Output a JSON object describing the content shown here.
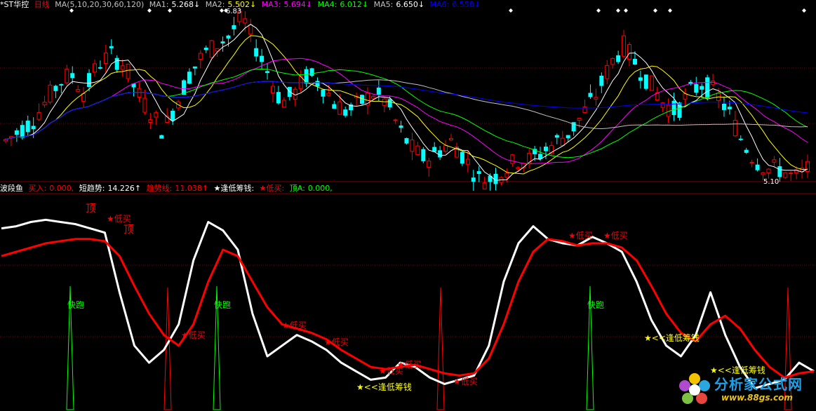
{
  "colors": {
    "white": "#ffffff",
    "yellow": "#ffff00",
    "magenta": "#ff00ff",
    "green": "#00ff00",
    "blue": "#0000ff",
    "red": "#ff0000",
    "cyan": "#00ffff",
    "gray": "#c0c0c0",
    "sep": "#800000",
    "mid": "#666666"
  },
  "top_legend": {
    "symbol": "*ST华控",
    "period": "日线",
    "ma_label": "MA(5,10,20,30,60,120)",
    "ma1_label": "MA1:",
    "ma1_value": "5.268↓",
    "ma2_label": "MA2:",
    "ma2_value": "5.502↓",
    "ma3_label": "MA3:",
    "ma3_value": "5.694↓",
    "ma4_label": "MA4:",
    "ma4_value": "6.012↓",
    "ma5_label": "MA5:",
    "ma5_value": "6.650↓",
    "ma6_label": "MA6:",
    "ma6_value": "6.558↓"
  },
  "bottom_legend": {
    "indicator": "波段鱼",
    "buy_label": "买入:",
    "buy_value": "0.000,",
    "short_label": "短趋势:",
    "short_value": "14.226↑",
    "trend_label": "趋势线:",
    "trend_value": "11.038↑",
    "chip_label": "★逢低筹钱:",
    "lowbuy_label": "★低买:",
    "top_label": "顶A:",
    "top_value": "0.000,"
  },
  "price_labels": {
    "high": "6.83",
    "low": "5.10"
  },
  "annotations": {
    "top": "顶",
    "low_buy": "★低买",
    "quick_run": "快跑",
    "chip": "★<<逢低筹钱"
  },
  "watermark": {
    "name": "分析家公式网",
    "url": "www.88gs.com"
  },
  "chart_data": [
    {
      "type": "candlestick",
      "price_range": [
        5.1,
        6.83
      ],
      "close_trend": [
        5.5,
        5.6,
        5.7,
        5.9,
        6.1,
        6.2,
        6.0,
        6.3,
        6.4,
        6.3,
        6.0,
        5.8,
        5.6,
        5.9,
        6.2,
        6.4,
        6.5,
        6.6,
        6.8,
        6.5,
        6.2,
        5.9,
        6.0,
        6.2,
        6.1,
        5.9,
        5.8,
        5.9,
        6.0,
        5.9,
        5.6,
        5.4,
        5.3,
        5.4,
        5.5,
        5.3,
        5.1,
        5.1,
        5.2,
        5.3,
        5.3,
        5.4,
        5.5,
        5.6,
        5.8,
        6.0,
        6.3,
        6.5,
        6.3,
        6.1,
        5.9,
        5.8,
        6.0,
        6.1,
        6.0,
        5.8,
        5.5,
        5.3,
        5.2,
        5.2,
        5.1,
        5.2
      ],
      "moving_averages": [
        "MA1",
        "MA2",
        "MA3",
        "MA4",
        "MA5",
        "MA6"
      ]
    },
    {
      "type": "line",
      "series": [
        {
          "name": "短趋势",
          "values": [
            85,
            86,
            88,
            89,
            88,
            87,
            85,
            83,
            55,
            30,
            22,
            28,
            40,
            70,
            88,
            84,
            75,
            45,
            25,
            30,
            35,
            32,
            28,
            22,
            18,
            14,
            15,
            22,
            20,
            15,
            12,
            14,
            16,
            30,
            60,
            78,
            86,
            80,
            78,
            77,
            81,
            78,
            74,
            60,
            42,
            30,
            25,
            35,
            55,
            35,
            20,
            10,
            12,
            14,
            22,
            18
          ]
        },
        {
          "name": "趋势线",
          "values": [
            72,
            74,
            76,
            78,
            79,
            80,
            80,
            79,
            72,
            58,
            45,
            35,
            30,
            40,
            60,
            75,
            72,
            60,
            48,
            40,
            38,
            36,
            33,
            28,
            24,
            20,
            19,
            20,
            21,
            19,
            17,
            16,
            17,
            24,
            40,
            60,
            74,
            80,
            79,
            77,
            78,
            78,
            76,
            70,
            58,
            45,
            36,
            32,
            40,
            44,
            38,
            28,
            20,
            15,
            17,
            18
          ]
        }
      ],
      "y_range": [
        0,
        100
      ]
    }
  ]
}
